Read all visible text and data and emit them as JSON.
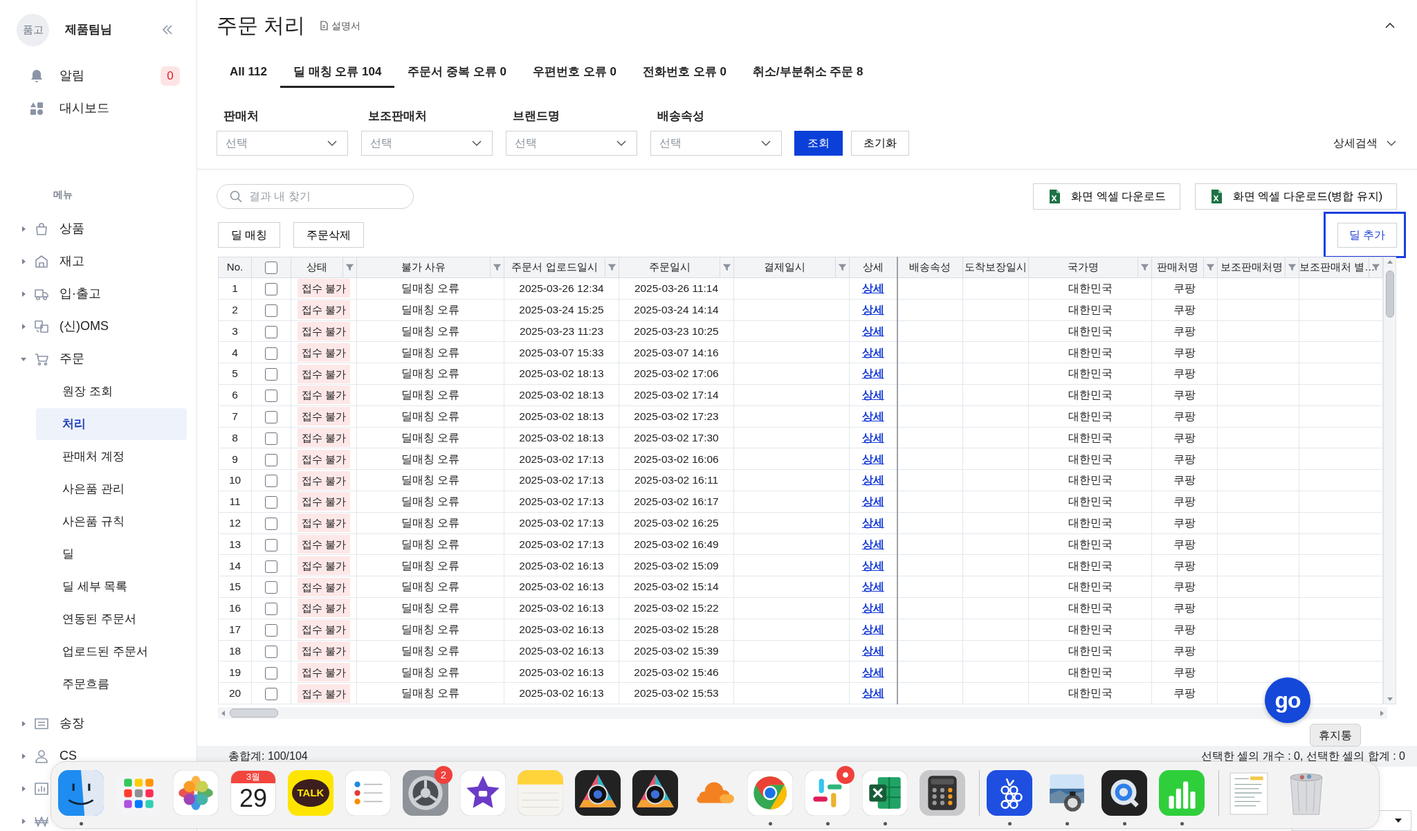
{
  "sidebar": {
    "avatar": "품고",
    "user": "제품팀님",
    "alerts": {
      "label": "알림",
      "count": "0"
    },
    "dashboard": "대시보드",
    "menu_title": "메뉴",
    "menu": [
      {
        "kind": "bag",
        "label": "상품",
        "expanded": false
      },
      {
        "kind": "store",
        "label": "재고",
        "expanded": false
      },
      {
        "kind": "truck",
        "label": "입·출고",
        "expanded": false
      },
      {
        "kind": "oms",
        "label": "(신)OMS",
        "expanded": false
      },
      {
        "kind": "cart",
        "label": "주문",
        "expanded": true,
        "children": [
          {
            "label": "원장 조회",
            "selected": false
          },
          {
            "label": "처리",
            "selected": true
          },
          {
            "label": "판매처 계정",
            "selected": false
          },
          {
            "label": "사은품 관리",
            "selected": false
          },
          {
            "label": "사은품 규칙",
            "selected": false
          },
          {
            "label": "딜",
            "selected": false
          },
          {
            "label": "딜 세부 목록",
            "selected": false
          },
          {
            "label": "연동된 주문서",
            "selected": false
          },
          {
            "label": "업로드된 주문서",
            "selected": false
          },
          {
            "label": "주문흐름",
            "selected": false
          }
        ]
      },
      {
        "kind": "receipt",
        "label": "송장",
        "expanded": false
      },
      {
        "kind": "person",
        "label": "CS",
        "expanded": false
      },
      {
        "kind": "chart",
        "expanded": false
      },
      {
        "kind": "won",
        "expanded": false
      }
    ]
  },
  "header": {
    "title": "주문 처리",
    "manual": "설명서"
  },
  "tabs": [
    {
      "label": "All 112",
      "selected": false
    },
    {
      "label": "딜 매칭 오류 104",
      "selected": true
    },
    {
      "label": "주문서 중복 오류 0",
      "selected": false
    },
    {
      "label": "우편번호 오류 0",
      "selected": false
    },
    {
      "label": "전화번호 오류 0",
      "selected": false
    },
    {
      "label": "취소/부분취소 주문 8",
      "selected": false
    }
  ],
  "filters": [
    {
      "label": "판매처",
      "placeholder": "선택"
    },
    {
      "label": "보조판매처",
      "placeholder": "선택"
    },
    {
      "label": "브랜드명",
      "placeholder": "선택"
    },
    {
      "label": "배송속성",
      "placeholder": "선택"
    }
  ],
  "search_button": "조회",
  "reset_button": "초기화",
  "advanced_search": "상세검색",
  "result_search": {
    "placeholder": "결과 내 찾기"
  },
  "excel_buttons": [
    "화면 엑셀 다운로드",
    "화면 엑셀 다운로드(병합 유지)"
  ],
  "actions": [
    "딜 매칭",
    "주문삭제"
  ],
  "deal_add": {
    "label": "딜 추가",
    "highlighted": true
  },
  "table": {
    "columns": [
      {
        "label": "No.",
        "filter": false
      },
      {
        "kind": "checkbox",
        "checked": false,
        "filter": false
      },
      {
        "label": "상태",
        "filter": true
      },
      {
        "label": "불가 사유",
        "filter": true
      },
      {
        "label": "주문서 업로드일시",
        "filter": true
      },
      {
        "label": "주문일시",
        "filter": true
      },
      {
        "label": "결제일시",
        "filter": true
      },
      {
        "label": "상세",
        "filter": false
      },
      {
        "label": "배송속성",
        "filter": false
      },
      {
        "label": "도착보장일시",
        "filter": false
      },
      {
        "label": "국가명",
        "filter": true
      },
      {
        "label": "판매처명",
        "filter": true
      },
      {
        "label": "보조판매처명",
        "filter": true
      },
      {
        "label": "보조판매처 별…",
        "filter": true
      }
    ],
    "rows": [
      {
        "no": "1",
        "checked": false,
        "status": "접수 불가",
        "reason": "딜매칭 오류",
        "uploaded": "2025-03-26 12:34",
        "ordered": "2025-03-26 11:14",
        "detail": "상세",
        "country": "대한민국",
        "seller": "쿠팡"
      },
      {
        "no": "2",
        "checked": false,
        "status": "접수 불가",
        "reason": "딜매칭 오류",
        "uploaded": "2025-03-24 15:25",
        "ordered": "2025-03-24 14:14",
        "detail": "상세",
        "country": "대한민국",
        "seller": "쿠팡"
      },
      {
        "no": "3",
        "checked": false,
        "status": "접수 불가",
        "reason": "딜매칭 오류",
        "uploaded": "2025-03-23 11:23",
        "ordered": "2025-03-23 10:25",
        "detail": "상세",
        "country": "대한민국",
        "seller": "쿠팡"
      },
      {
        "no": "4",
        "checked": false,
        "status": "접수 불가",
        "reason": "딜매칭 오류",
        "uploaded": "2025-03-07 15:33",
        "ordered": "2025-03-07 14:16",
        "detail": "상세",
        "country": "대한민국",
        "seller": "쿠팡"
      },
      {
        "no": "5",
        "checked": false,
        "status": "접수 불가",
        "reason": "딜매칭 오류",
        "uploaded": "2025-03-02 18:13",
        "ordered": "2025-03-02 17:06",
        "detail": "상세",
        "country": "대한민국",
        "seller": "쿠팡"
      },
      {
        "no": "6",
        "checked": false,
        "status": "접수 불가",
        "reason": "딜매칭 오류",
        "uploaded": "2025-03-02 18:13",
        "ordered": "2025-03-02 17:14",
        "detail": "상세",
        "country": "대한민국",
        "seller": "쿠팡"
      },
      {
        "no": "7",
        "checked": false,
        "status": "접수 불가",
        "reason": "딜매칭 오류",
        "uploaded": "2025-03-02 18:13",
        "ordered": "2025-03-02 17:23",
        "detail": "상세",
        "country": "대한민국",
        "seller": "쿠팡"
      },
      {
        "no": "8",
        "checked": false,
        "status": "접수 불가",
        "reason": "딜매칭 오류",
        "uploaded": "2025-03-02 18:13",
        "ordered": "2025-03-02 17:30",
        "detail": "상세",
        "country": "대한민국",
        "seller": "쿠팡"
      },
      {
        "no": "9",
        "checked": false,
        "status": "접수 불가",
        "reason": "딜매칭 오류",
        "uploaded": "2025-03-02 17:13",
        "ordered": "2025-03-02 16:06",
        "detail": "상세",
        "country": "대한민국",
        "seller": "쿠팡"
      },
      {
        "no": "10",
        "checked": false,
        "status": "접수 불가",
        "reason": "딜매칭 오류",
        "uploaded": "2025-03-02 17:13",
        "ordered": "2025-03-02 16:11",
        "detail": "상세",
        "country": "대한민국",
        "seller": "쿠팡"
      },
      {
        "no": "11",
        "checked": false,
        "status": "접수 불가",
        "reason": "딜매칭 오류",
        "uploaded": "2025-03-02 17:13",
        "ordered": "2025-03-02 16:17",
        "detail": "상세",
        "country": "대한민국",
        "seller": "쿠팡"
      },
      {
        "no": "12",
        "checked": false,
        "status": "접수 불가",
        "reason": "딜매칭 오류",
        "uploaded": "2025-03-02 17:13",
        "ordered": "2025-03-02 16:25",
        "detail": "상세",
        "country": "대한민국",
        "seller": "쿠팡"
      },
      {
        "no": "13",
        "checked": false,
        "status": "접수 불가",
        "reason": "딜매칭 오류",
        "uploaded": "2025-03-02 17:13",
        "ordered": "2025-03-02 16:49",
        "detail": "상세",
        "country": "대한민국",
        "seller": "쿠팡"
      },
      {
        "no": "14",
        "checked": false,
        "status": "접수 불가",
        "reason": "딜매칭 오류",
        "uploaded": "2025-03-02 16:13",
        "ordered": "2025-03-02 15:09",
        "detail": "상세",
        "country": "대한민국",
        "seller": "쿠팡"
      },
      {
        "no": "15",
        "checked": false,
        "status": "접수 불가",
        "reason": "딜매칭 오류",
        "uploaded": "2025-03-02 16:13",
        "ordered": "2025-03-02 15:14",
        "detail": "상세",
        "country": "대한민국",
        "seller": "쿠팡"
      },
      {
        "no": "16",
        "checked": false,
        "status": "접수 불가",
        "reason": "딜매칭 오류",
        "uploaded": "2025-03-02 16:13",
        "ordered": "2025-03-02 15:22",
        "detail": "상세",
        "country": "대한민국",
        "seller": "쿠팡"
      },
      {
        "no": "17",
        "checked": false,
        "status": "접수 불가",
        "reason": "딜매칭 오류",
        "uploaded": "2025-03-02 16:13",
        "ordered": "2025-03-02 15:28",
        "detail": "상세",
        "country": "대한민국",
        "seller": "쿠팡"
      },
      {
        "no": "18",
        "checked": false,
        "status": "접수 불가",
        "reason": "딜매칭 오류",
        "uploaded": "2025-03-02 16:13",
        "ordered": "2025-03-02 15:39",
        "detail": "상세",
        "country": "대한민국",
        "seller": "쿠팡"
      },
      {
        "no": "19",
        "checked": false,
        "status": "접수 불가",
        "reason": "딜매칭 오류",
        "uploaded": "2025-03-02 16:13",
        "ordered": "2025-03-02 15:46",
        "detail": "상세",
        "country": "대한민국",
        "seller": "쿠팡"
      },
      {
        "no": "20",
        "checked": false,
        "status": "접수 불가",
        "reason": "딜매칭 오류",
        "uploaded": "2025-03-02 16:13",
        "ordered": "2025-03-02 15:53",
        "detail": "상세",
        "country": "대한민국",
        "seller": "쿠팡"
      }
    ]
  },
  "footer": {
    "total": "총합계: 100/104",
    "selection": "선택한 셀의 개수 : 0, 선택한 셀의 합계 : 0"
  },
  "floating_button": {
    "label": "go"
  },
  "dock": {
    "tooltip": "휴지통",
    "items": [
      {
        "kind": "finder",
        "running": true,
        "alert": false
      },
      {
        "kind": "launchpad",
        "running": false,
        "alert": false
      },
      {
        "kind": "photos",
        "running": false,
        "alert": false
      },
      {
        "kind": "calendar",
        "month": "3월",
        "day": "29",
        "running": false,
        "alert": false
      },
      {
        "kind": "talk",
        "label": "TALK",
        "running": false,
        "alert": false
      },
      {
        "kind": "reminders",
        "running": false,
        "alert": false
      },
      {
        "kind": "settings",
        "badge": "2",
        "running": false,
        "alert": false
      },
      {
        "kind": "imovie",
        "running": false,
        "alert": false
      },
      {
        "kind": "notes",
        "running": false,
        "alert": false
      },
      {
        "kind": "camera",
        "running": false,
        "alert": false
      },
      {
        "kind": "camera",
        "running": false,
        "alert": false
      },
      {
        "kind": "cloud",
        "running": false,
        "alert": false
      },
      {
        "kind": "chrome",
        "running": true,
        "alert": false
      },
      {
        "kind": "slack",
        "running": true,
        "alert": true
      },
      {
        "kind": "excel",
        "running": true,
        "alert": false
      },
      {
        "kind": "calculator",
        "running": false,
        "alert": false
      },
      {
        "kind": "separator"
      },
      {
        "kind": "grape",
        "running": true,
        "alert": false
      },
      {
        "kind": "preview",
        "running": true,
        "alert": false
      },
      {
        "kind": "quicktime",
        "running": true,
        "alert": false
      },
      {
        "kind": "numbers",
        "running": true,
        "alert": false
      },
      {
        "kind": "separator"
      },
      {
        "kind": "document",
        "running": false,
        "alert": false
      },
      {
        "kind": "trash",
        "running": false,
        "alert": false
      }
    ]
  }
}
